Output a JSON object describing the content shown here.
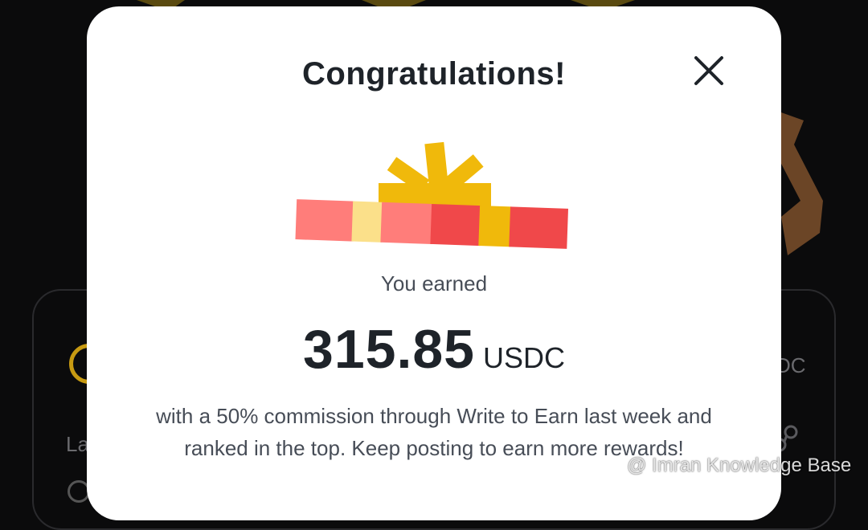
{
  "background": {
    "left_text": "La",
    "right_text": "DC"
  },
  "modal": {
    "title": "Congratulations!",
    "close_icon": "close-icon",
    "illustration": "gift-box-icon",
    "earned_label": "You earned",
    "amount": "315.85",
    "currency": "USDC",
    "message": "with a 50% commission through Write to Earn last week and ranked in the top. Keep posting to earn more rewards!"
  },
  "watermark": {
    "text": "@ Imran Knowledge Base"
  },
  "colors": {
    "title": "#1e2329",
    "body_text": "#474d57",
    "gift_red": "#f0484a",
    "gift_pink": "#ff7d7a",
    "gift_gold": "#f0b90b",
    "gift_light": "#fbe08a",
    "backdrop": "#0b0b0c"
  }
}
